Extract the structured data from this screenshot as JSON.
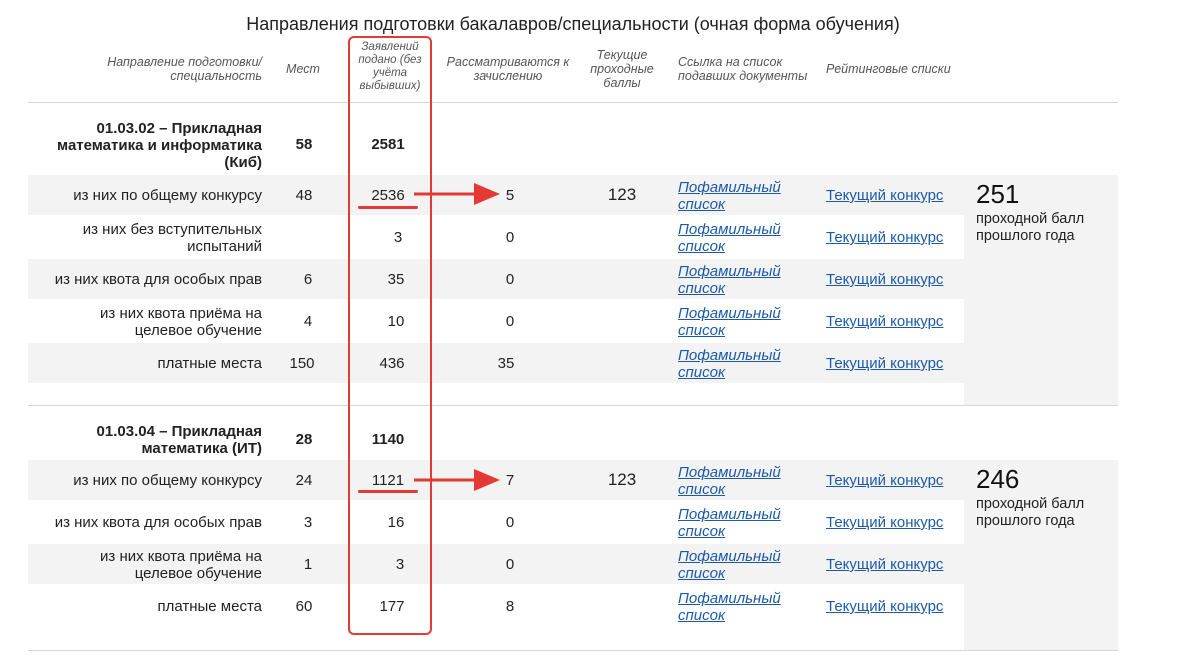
{
  "title": "Направления подготовки бакалавров/специальности (очная форма обучения)",
  "headers": {
    "direction": "Направление подготовки/ специальность",
    "places": "Мест",
    "applications": "Заявлений подано (без учёта выбывших)",
    "considered": "Рассматриваются к зачислению",
    "current_score": "Текущие проходные баллы",
    "list_link": "Ссылка на список подавших документы",
    "ranking": "Рейтинговые списки"
  },
  "programs": [
    {
      "name": "01.03.02 – Прикладная математика и информатика (Киб)",
      "places": "58",
      "applications": "2581",
      "passing_score_last_year": "251",
      "passing_score_caption": "проходной балл прошлого года",
      "rows": [
        {
          "label": "из них по общему конкурсу",
          "places": "48",
          "applications": "2536",
          "considered": "5",
          "score": "123",
          "list_link": "Пофамильный список",
          "ranking_link": "Текущий конкурс"
        },
        {
          "label": "из них без вступительных испытаний",
          "places": "",
          "applications": "3",
          "considered": "0",
          "score": "",
          "list_link": "Пофамильный список",
          "ranking_link": "Текущий конкурс"
        },
        {
          "label": "из них квота для особых прав",
          "places": "6",
          "applications": "35",
          "considered": "0",
          "score": "",
          "list_link": "Пофамильный список",
          "ranking_link": "Текущий конкурс"
        },
        {
          "label": "из них квота приёма на целевое обучение",
          "places": "4",
          "applications": "10",
          "considered": "0",
          "score": "",
          "list_link": "Пофамильный список",
          "ranking_link": "Текущий конкурс"
        },
        {
          "label": "платные места",
          "places": "150",
          "applications": "436",
          "considered": "35",
          "score": "",
          "list_link": "Пофамильный список",
          "ranking_link": "Текущий конкурс"
        }
      ]
    },
    {
      "name": "01.03.04 – Прикладная математика (ИТ)",
      "places": "28",
      "applications": "1140",
      "passing_score_last_year": "246",
      "passing_score_caption": "проходной балл прошлого года",
      "rows": [
        {
          "label": "из них по общему конкурсу",
          "places": "24",
          "applications": "1121",
          "considered": "7",
          "score": "123",
          "list_link": "Пофамильный список",
          "ranking_link": "Текущий конкурс"
        },
        {
          "label": "из них квота для особых прав",
          "places": "3",
          "applications": "16",
          "considered": "0",
          "score": "",
          "list_link": "Пофамильный список",
          "ranking_link": "Текущий конкурс"
        },
        {
          "label": "из них квота приёма на целевое обучение",
          "places": "1",
          "applications": "3",
          "considered": "0",
          "score": "",
          "list_link": "Пофамильный список",
          "ranking_link": "Текущий конкурс"
        },
        {
          "label": "платные места",
          "places": "60",
          "applications": "177",
          "considered": "8",
          "score": "",
          "list_link": "Пофамильный список",
          "ranking_link": "Текущий конкурс"
        }
      ]
    }
  ],
  "annotation_color": "#e53935"
}
